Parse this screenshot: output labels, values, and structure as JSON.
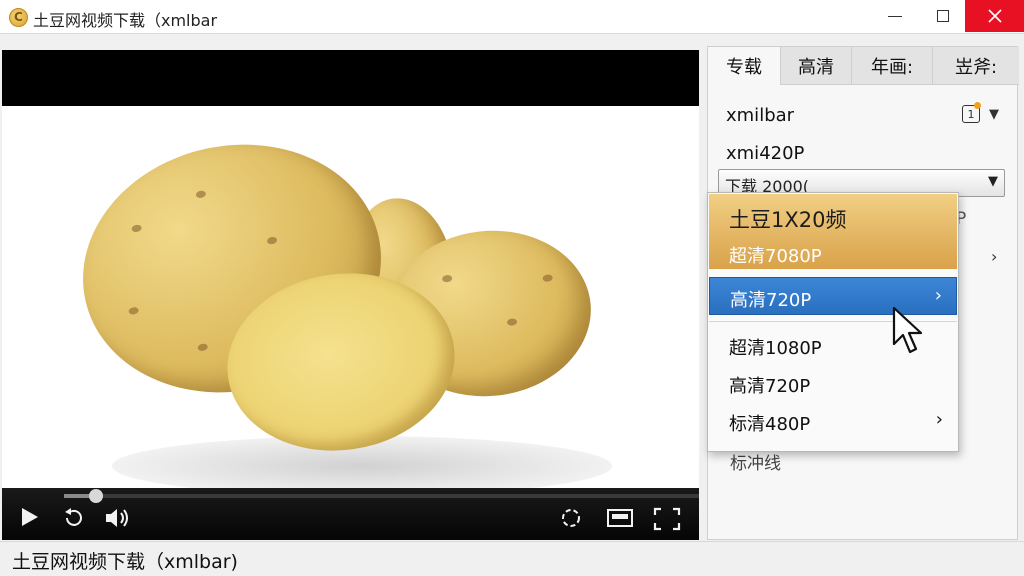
{
  "window": {
    "title": "土豆网视频下载（xmlbar",
    "app_icon_glyph": "C"
  },
  "controls": {
    "progress_fraction": 0.05
  },
  "panel": {
    "tabs": [
      {
        "label": "专载",
        "active": true
      },
      {
        "label": "高清",
        "active": false
      },
      {
        "label": "年画:",
        "active": false
      },
      {
        "label": "岦斧:",
        "active": false
      }
    ],
    "row1": "xmilbar",
    "row2": "xmi420P",
    "select_value": "下载 2000(",
    "behind_text_1": "P",
    "behind_text_3": "标冲线"
  },
  "menu": {
    "header_title": "土豆1X20频",
    "header_subtitle": "超清7080P",
    "selected_item": "高清720P",
    "items": [
      {
        "label": "超清1080P",
        "has_submenu": false
      },
      {
        "label": "高清720P",
        "has_submenu": false
      },
      {
        "label": "标清480P",
        "has_submenu": true
      }
    ]
  },
  "statusbar": {
    "text": "土豆网视频下载（xmlbar)"
  },
  "colors": {
    "accent": "#2a6fc0",
    "close_button": "#e81123",
    "menu_header": "#d9a24a"
  }
}
